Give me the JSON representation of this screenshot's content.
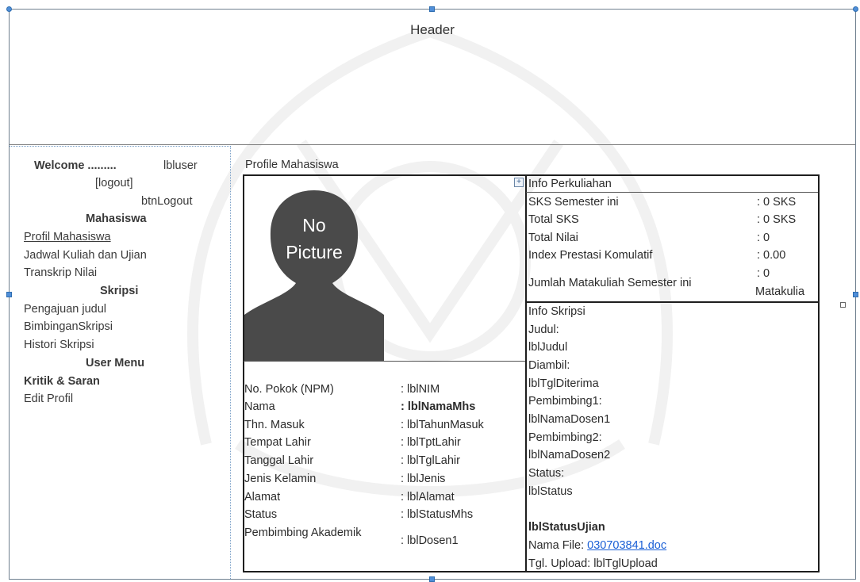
{
  "header": {
    "title": "Header"
  },
  "sidebar": {
    "welcome_label": "Welcome .........",
    "user_label": "lbluser",
    "logout_label": "[logout]",
    "logout_button_id": "btnLogout",
    "section_mahasiswa": "Mahasiswa",
    "mahasiswa_items": [
      "Profil Mahasiswa",
      "Jadwal Kuliah dan Ujian",
      "Transkrip Nilai"
    ],
    "section_skripsi": "Skripsi",
    "skripsi_items": [
      "Pengajuan judul",
      "BimbinganSkripsi",
      "Histori Skripsi"
    ],
    "section_user_menu": "User Menu",
    "user_menu_items": [
      "Kritik & Saran",
      "Edit Profil"
    ]
  },
  "main": {
    "title": "Profile Mahasiswa",
    "photo": {
      "line1": "No",
      "line2": "Picture"
    },
    "profile_rows": [
      {
        "label": "No. Pokok (NPM)",
        "value": ": lblNIM"
      },
      {
        "label": "Nama",
        "value": ": lblNamaMhs"
      },
      {
        "label": "Thn. Masuk",
        "value": ": lblTahunMasuk"
      },
      {
        "label": "Tempat Lahir",
        "value": ": lblTptLahir"
      },
      {
        "label": "Tanggal Lahir",
        "value": ": lblTglLahir"
      },
      {
        "label": "Jenis Kelamin",
        "value": ": lblJenis"
      },
      {
        "label": "Alamat",
        "value": ": lblAlamat"
      },
      {
        "label": "Status",
        "value": ": lblStatusMhs"
      },
      {
        "label": "Pembimbing Akademik",
        "value": ": lblDosen1"
      }
    ],
    "info_perkuliahan": {
      "title": "Info Perkuliahan",
      "rows": [
        {
          "label": "SKS Semester ini",
          "value": ": 0 SKS"
        },
        {
          "label": "Total SKS",
          "value": ": 0 SKS"
        },
        {
          "label": "Total Nilai",
          "value": ": 0"
        },
        {
          "label": "Index Prestasi Komulatif",
          "value": ": 0.00"
        },
        {
          "label": "Jumlah Matakuliah Semester ini",
          "value_line1": ": 0",
          "value_line2": "Matakulia"
        }
      ]
    },
    "info_skripsi": {
      "title": "Info Skripsi",
      "lines": [
        "Judul:",
        "lblJudul",
        "Diambil:",
        "lblTglDiterima",
        "Pembimbing1:",
        "lblNamaDosen1",
        "Pembimbing2:",
        "lblNamaDosen2",
        "Status:",
        "lblStatus"
      ],
      "status_ujian": "lblStatusUjian",
      "file_label": "Nama File: ",
      "file_name": "030703841.doc",
      "upload_label": "Tgl. Upload: lblTglUpload"
    }
  },
  "colors": {
    "link": "#1a5fd6",
    "handle": "#4f8ed8",
    "border": "#1e1e1e"
  }
}
